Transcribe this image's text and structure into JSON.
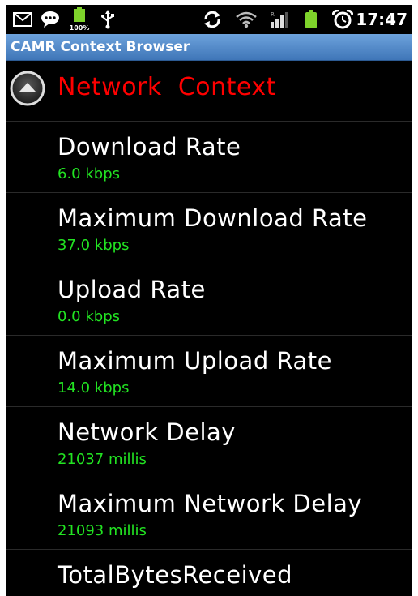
{
  "status_bar": {
    "icons": [
      "mail-icon",
      "chat-icon",
      "battery-icon",
      "usb-icon",
      "sync-icon",
      "wifi-icon",
      "signal-icon",
      "battery-charging-icon",
      "alarm-icon"
    ],
    "battery_label": "100%",
    "time": "17:47"
  },
  "app": {
    "title": "CAMR Context Browser"
  },
  "group": {
    "title": "Network  Context",
    "color": "#ff0000"
  },
  "items": [
    {
      "label": "Download Rate",
      "value": "6.0 kbps"
    },
    {
      "label": "Maximum Download Rate",
      "value": "37.0 kbps"
    },
    {
      "label": "Upload Rate",
      "value": "0.0 kbps"
    },
    {
      "label": "Maximum Upload Rate",
      "value": "14.0 kbps"
    },
    {
      "label": "Network Delay",
      "value": "21037 millis"
    },
    {
      "label": "Maximum Network Delay",
      "value": "21093 millis"
    },
    {
      "label": "TotalBytesReceived",
      "value": ""
    }
  ],
  "colors": {
    "value_text": "#22e322",
    "title_bar": "#4f86c6",
    "background": "#000000"
  }
}
